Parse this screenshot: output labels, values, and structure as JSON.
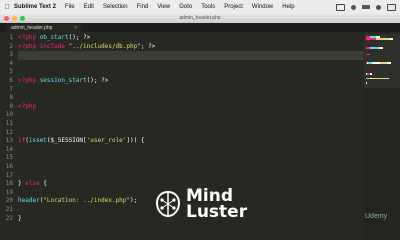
{
  "menubar": {
    "app_name": "Sublime Text 2",
    "items": [
      "File",
      "Edit",
      "Selection",
      "Find",
      "View",
      "Goto",
      "Tools",
      "Project",
      "Window",
      "Help"
    ]
  },
  "window": {
    "title": "admin_header.php",
    "tab_label": "admin_header.php"
  },
  "line_numbers": [
    "1",
    "2",
    "3",
    "4",
    "5",
    "6",
    "7",
    "8",
    "9",
    "10",
    "11",
    "12",
    "13",
    "14",
    "15",
    "16",
    "17",
    "18",
    "19",
    "20",
    "21",
    "22"
  ],
  "code_lines": [
    {
      "n": 1,
      "parts": [
        {
          "t": "<?php ",
          "c": "t-tag"
        },
        {
          "t": "ob_start",
          "c": "t-fn"
        },
        {
          "t": "(); ?>",
          "c": "t-var"
        }
      ]
    },
    {
      "n": 2,
      "parts": [
        {
          "t": "<?php ",
          "c": "t-tag"
        },
        {
          "t": "include ",
          "c": "t-kw"
        },
        {
          "t": "\"../includes/db.php\"",
          "c": "t-str"
        },
        {
          "t": "; ?>",
          "c": "t-var"
        }
      ]
    },
    {
      "n": 3,
      "parts": []
    },
    {
      "n": 4,
      "parts": []
    },
    {
      "n": 5,
      "parts": []
    },
    {
      "n": 6,
      "parts": [
        {
          "t": "<?php ",
          "c": "t-tag"
        },
        {
          "t": "session_start",
          "c": "t-fn"
        },
        {
          "t": "(); ?>",
          "c": "t-var"
        }
      ]
    },
    {
      "n": 7,
      "parts": []
    },
    {
      "n": 8,
      "parts": []
    },
    {
      "n": 9,
      "parts": [
        {
          "t": "<?php",
          "c": "t-tag"
        }
      ]
    },
    {
      "n": 10,
      "parts": []
    },
    {
      "n": 11,
      "parts": []
    },
    {
      "n": 12,
      "parts": []
    },
    {
      "n": 13,
      "parts": [
        {
          "t": "if",
          "c": "t-kw"
        },
        {
          "t": "(",
          "c": "t-var"
        },
        {
          "t": "isset",
          "c": "t-fn"
        },
        {
          "t": "($_SESSION[",
          "c": "t-var"
        },
        {
          "t": "'user_role'",
          "c": "t-str"
        },
        {
          "t": "])) {",
          "c": "t-var"
        }
      ]
    },
    {
      "n": 14,
      "parts": []
    },
    {
      "n": 15,
      "parts": []
    },
    {
      "n": 16,
      "parts": []
    },
    {
      "n": 17,
      "parts": []
    },
    {
      "n": 18,
      "parts": [
        {
          "t": "} ",
          "c": "t-var"
        },
        {
          "t": "else",
          "c": "t-kw"
        },
        {
          "t": " {",
          "c": "t-var"
        }
      ]
    },
    {
      "n": 19,
      "parts": []
    },
    {
      "n": 20,
      "parts": [
        {
          "t": "header",
          "c": "t-fn"
        },
        {
          "t": "(",
          "c": "t-var"
        },
        {
          "t": "\"Location: ../index.php\"",
          "c": "t-str"
        },
        {
          "t": ");",
          "c": "t-var"
        }
      ]
    },
    {
      "n": 21,
      "parts": []
    },
    {
      "n": 22,
      "parts": [
        {
          "t": "}",
          "c": "t-var"
        }
      ]
    }
  ],
  "watermark": {
    "line1": "Mind",
    "line2": "Luster"
  },
  "corner_logo": "Udemy",
  "colors": {
    "editor_bg": "#272822",
    "keyword": "#f92672",
    "function": "#66d9ef",
    "string": "#e6db74"
  }
}
